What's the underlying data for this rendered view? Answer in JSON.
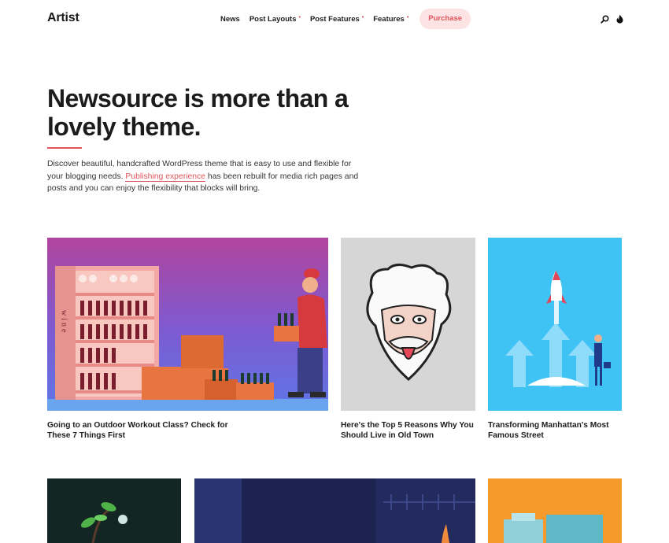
{
  "header": {
    "logo": "Artist",
    "nav": [
      {
        "label": "News",
        "has_dropdown": false
      },
      {
        "label": "Post Layouts",
        "has_dropdown": true
      },
      {
        "label": "Post Features",
        "has_dropdown": true
      },
      {
        "label": "Features",
        "has_dropdown": true
      }
    ],
    "dropdown_marker": "•",
    "purchase_label": "Purchase",
    "icons": [
      "search-icon",
      "flame-icon"
    ]
  },
  "hero": {
    "title": "Newsource is more than a lovely theme.",
    "text_before": "Discover beautiful, handcrafted WordPress theme that is easy to use and flexible for your blogging needs. ",
    "link_text": "Publishing experience",
    "text_after": " has been rebuilt for media rich pages and posts and you can enjoy the flexibility that blocks will bring."
  },
  "posts": [
    {
      "title": "Going to an Outdoor Workout Class? Check for These 7 Things First",
      "image": "wine-shop-delivery-illustration"
    },
    {
      "title": "Here's the Top 5 Reasons Why You Should Live in Old Town",
      "image": "einstein-tongue-illustration"
    },
    {
      "title": "Transforming Manhattan's Most Famous Street",
      "image": "rocket-launch-illustration"
    }
  ],
  "wine_label": "wine",
  "colors": {
    "accent": "#e5535c",
    "purchase_bg": "#fde3e4",
    "text": "#1c1c1c"
  }
}
